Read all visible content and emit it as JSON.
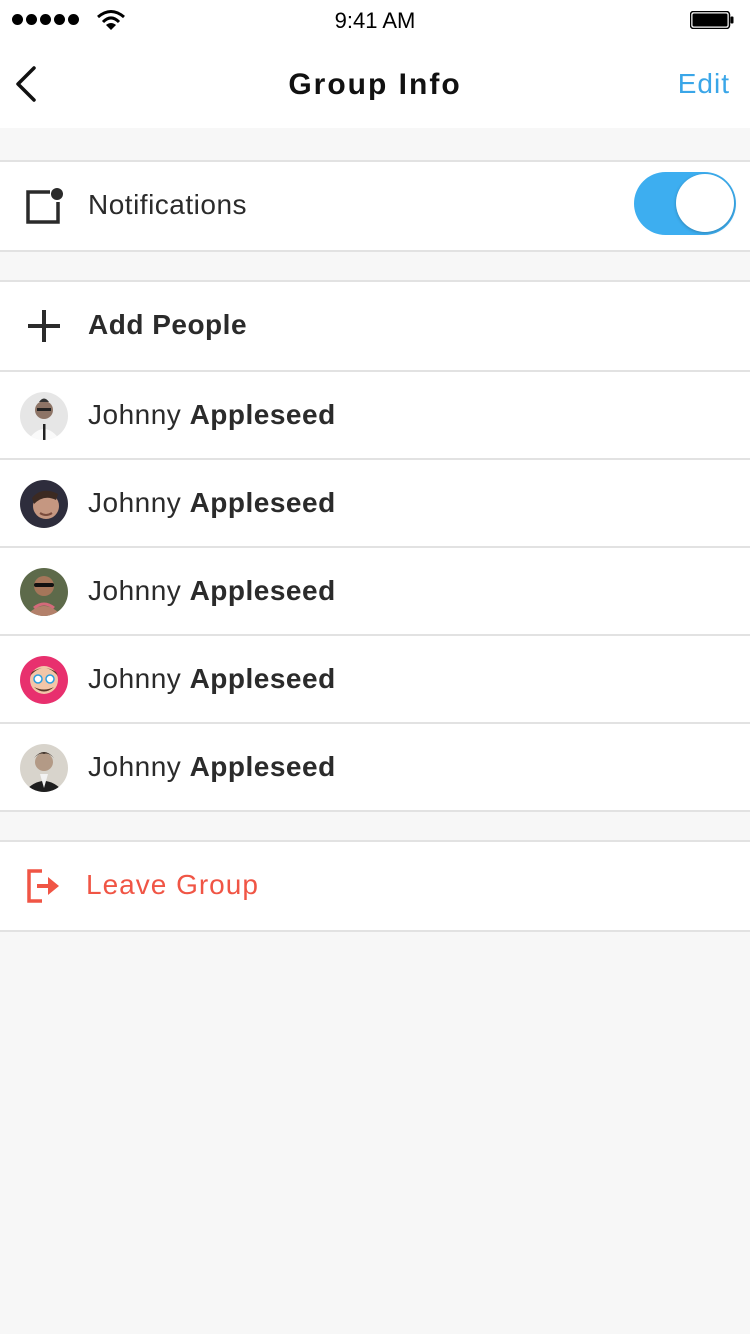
{
  "status_bar": {
    "time": "9:41 AM"
  },
  "nav": {
    "title": "Group Info",
    "edit_label": "Edit",
    "back_icon": "chevron-left-icon"
  },
  "notifications": {
    "label": "Notifications",
    "enabled": true,
    "icon": "notification-icon",
    "toggle_color": "#3daef0"
  },
  "add_people": {
    "label": "Add People",
    "icon": "plus-icon"
  },
  "members": [
    {
      "first": "Johnny",
      "last": "Appleseed"
    },
    {
      "first": "Johnny",
      "last": "Appleseed"
    },
    {
      "first": "Johnny",
      "last": "Appleseed"
    },
    {
      "first": "Johnny",
      "last": "Appleseed"
    },
    {
      "first": "Johnny",
      "last": "Appleseed"
    }
  ],
  "leave": {
    "label": "Leave Group",
    "icon": "exit-icon",
    "color": "#f05545"
  },
  "colors": {
    "accent": "#3aa6e8",
    "background": "#f7f7f7",
    "danger": "#f05545"
  }
}
